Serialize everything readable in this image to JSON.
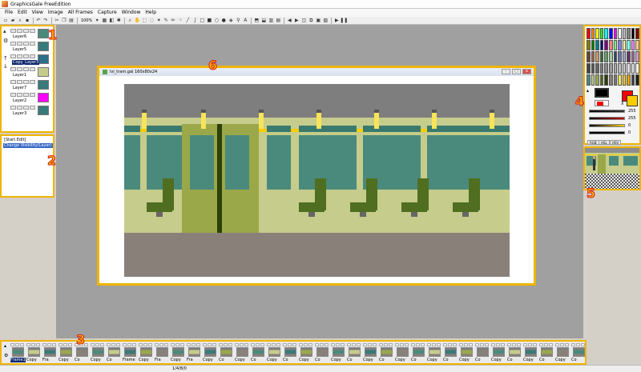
{
  "window": {
    "title": "GraphicsGale FreeEdition"
  },
  "menu": {
    "items": [
      "File",
      "Edit",
      "View",
      "Image",
      "All Frames",
      "Capture",
      "Window",
      "Help"
    ]
  },
  "toolbar": {
    "zoom": "100%"
  },
  "annotations": [
    "1",
    "2",
    "3",
    "4",
    "5",
    "6"
  ],
  "layers": [
    {
      "name": "Layer6",
      "color": "#4a8a7c"
    },
    {
      "name": "Layer5",
      "color": "#3a7a7a"
    },
    {
      "name": "Copy_Layer3",
      "color": "#2f6f8a",
      "selected": true
    },
    {
      "name": "Layer1",
      "color": "#c6cc8c"
    },
    {
      "name": "Layer7",
      "color": "#3a7a7a"
    },
    {
      "name": "Layer2",
      "color": "#ff00ff"
    },
    {
      "name": "Layer3",
      "color": "#3a7a7a"
    }
  ],
  "history": {
    "items": [
      "[Start Edit]",
      "Change Visibility(Layer)"
    ],
    "selected_index": 1
  },
  "document": {
    "title": "lvl_tram.gal 160x80x24",
    "buttons": [
      "-",
      "□",
      "x"
    ]
  },
  "palette": {
    "primary_color": "#ff0000",
    "secondary_color": "#ffcc00",
    "swap_label": "X",
    "sliders": [
      {
        "color": "#333333",
        "value": "255"
      },
      {
        "color": "#cc0000",
        "value": "255"
      },
      {
        "color": "#ffcc00",
        "value": "0"
      },
      {
        "color": "#111111",
        "value": "0"
      }
    ],
    "tabs": [
      "RGB",
      "HSL",
      "HSV"
    ],
    "swatches": [
      "#ff0000",
      "#ff8800",
      "#ffff00",
      "#00ff00",
      "#00ffff",
      "#0000ff",
      "#ff00ff",
      "#ffffff",
      "#c0c0c0",
      "#808080",
      "#000000",
      "#800000",
      "#808000",
      "#008000",
      "#008080",
      "#000080",
      "#800080",
      "#ff8080",
      "#80ff80",
      "#8080ff",
      "#ffff80",
      "#80ffff",
      "#ff80ff",
      "#ffcc99",
      "#664433",
      "#996644",
      "#cc9966",
      "#336633",
      "#669966",
      "#99cc99",
      "#334466",
      "#6677aa",
      "#99aacc",
      "#663366",
      "#996699",
      "#cc99cc",
      "#444444",
      "#555555",
      "#666666",
      "#777777",
      "#888888",
      "#999999",
      "#aaaaaa",
      "#bbbbbb",
      "#cccccc",
      "#dddddd",
      "#eeeeee",
      "#f5f5f5",
      "#4a8a7c",
      "#c6cc8c",
      "#9aa84a",
      "#4f6e1f",
      "#2d3f0a",
      "#8a807a",
      "#7a7a7a",
      "#f8e45a",
      "#ffcc00",
      "#e0a000",
      "#404040",
      "#202020"
    ]
  },
  "frames": {
    "labels": [
      "Frame1",
      "Copy",
      "Fra",
      "Copy",
      "Co",
      "Copy",
      "Co",
      "Frame",
      "Copy",
      "Fra",
      "Copy",
      "Fra",
      "Copy",
      "Co",
      "Copy",
      "Co",
      "Copy",
      "Co",
      "Copy",
      "Co",
      "Copy",
      "Co",
      "Copy",
      "Co",
      "Copy",
      "Co",
      "Copy",
      "Co",
      "Copy",
      "Co",
      "Copy",
      "Co",
      "Copy",
      "Co",
      "Copy",
      "Co"
    ],
    "selected_index": 0
  },
  "status": {
    "text": "1/4/8/0"
  }
}
